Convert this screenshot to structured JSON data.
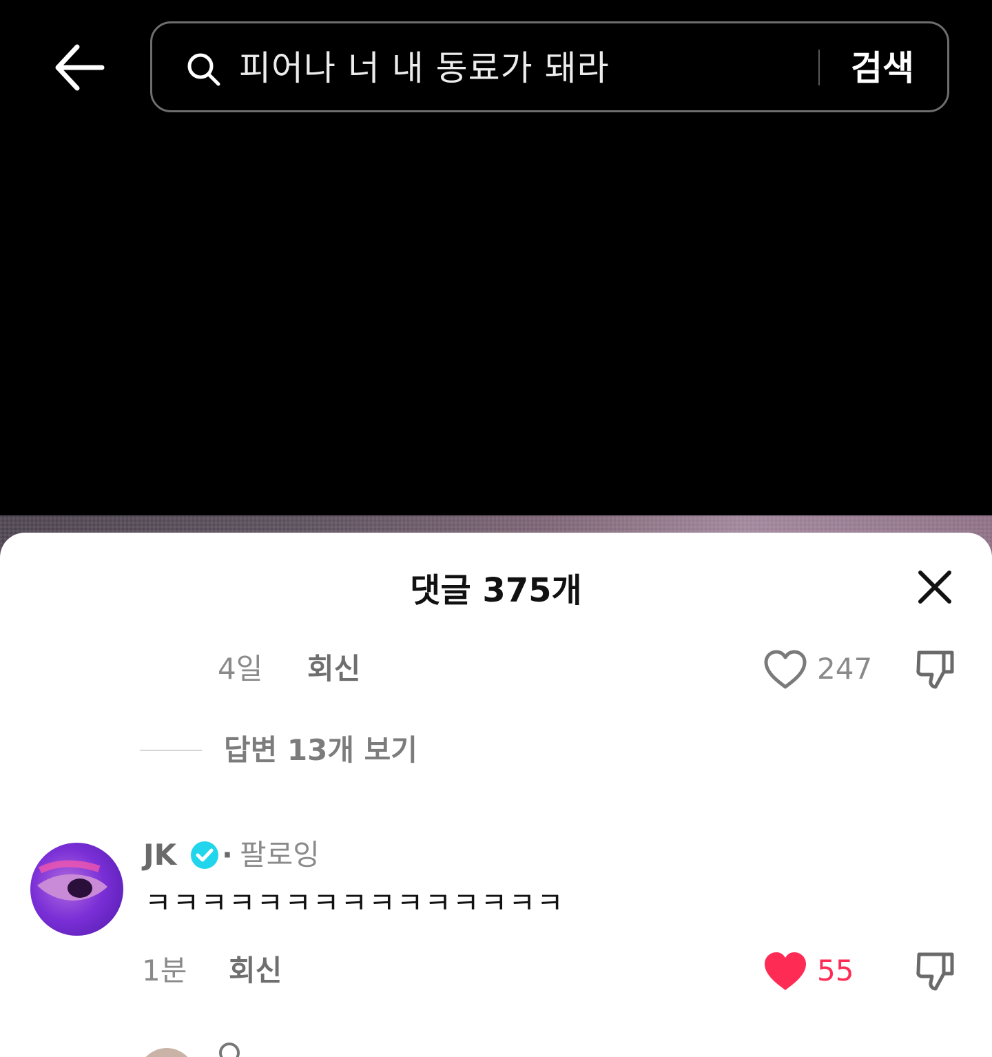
{
  "search": {
    "query": "피어나 너 내 동료가 돼라",
    "submit_label": "검색"
  },
  "comments_panel": {
    "title": "댓글 375개",
    "previous_comment": {
      "time": "4일",
      "reply_label": "회신",
      "like_count": "247",
      "view_replies_label": "답변 13개 보기"
    },
    "comment": {
      "username": "JK",
      "follow_status": "팔로잉",
      "text": "ㅋㅋㅋㅋㅋㅋㅋㅋㅋㅋㅋㅋㅋㅋㅋ",
      "time": "1분",
      "reply_label": "회신",
      "like_count": "55",
      "liked": true
    }
  },
  "icons": {
    "back": "arrow-left-icon",
    "search": "search-icon",
    "close": "close-icon",
    "like": "heart-icon",
    "dislike": "thumbs-down-icon",
    "verified": "verified-badge-icon"
  },
  "colors": {
    "accent_like": "#fe2c55",
    "verified": "#20d5ec"
  }
}
